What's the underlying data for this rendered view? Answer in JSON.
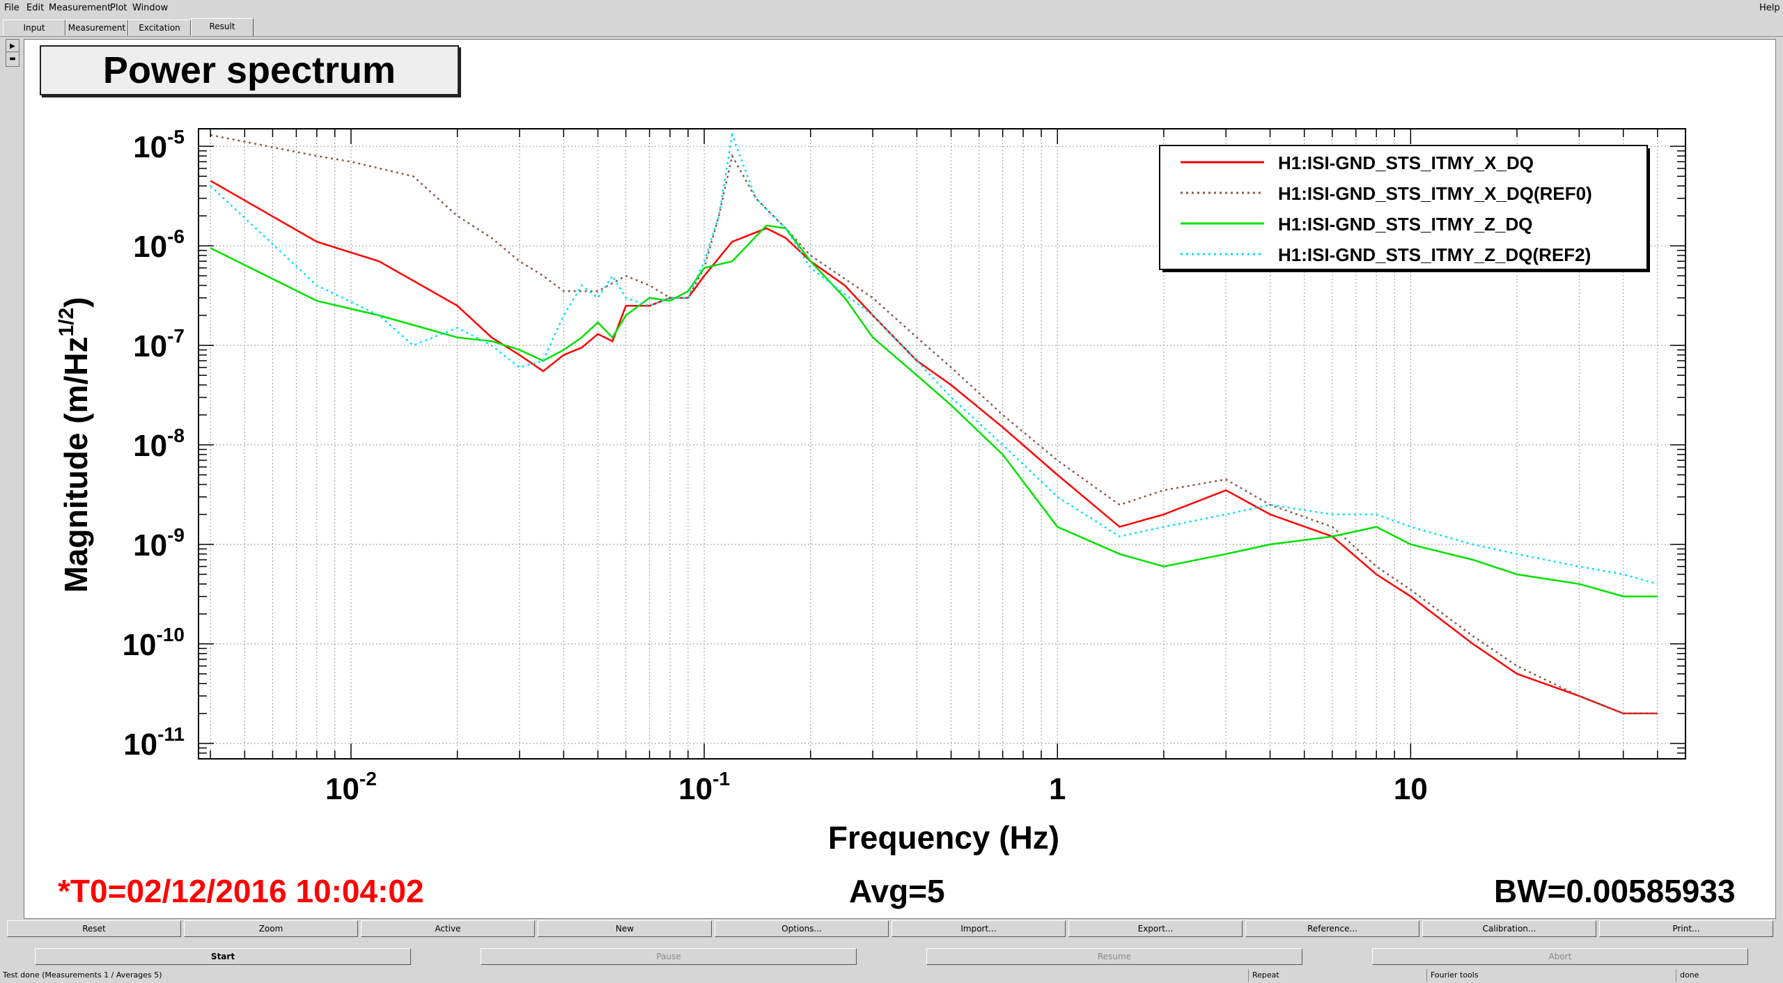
{
  "menu": {
    "items": [
      "File",
      "Edit",
      "Measurement",
      "Plot",
      "Window"
    ],
    "help": "Help"
  },
  "tabs": [
    "Input",
    "Measurement",
    "Excitation",
    "Result"
  ],
  "plot_title": "Power spectrum",
  "footer": {
    "t0": "*T0=02/12/2016 10:04:02",
    "avg": "Avg=5",
    "bw": "BW=0.00585933"
  },
  "buttons_row1": [
    "Reset",
    "Zoom",
    "Active",
    "New",
    "Options...",
    "Import...",
    "Export...",
    "Reference...",
    "Calibration...",
    "Print..."
  ],
  "buttons_row2": [
    "Start",
    "Pause",
    "Resume",
    "Abort"
  ],
  "status": {
    "left": "Test done (Measurements 1 / Averages 5)",
    "repeat": "Repeat",
    "fourier": "Fourier tools",
    "done": "done"
  },
  "colors": {
    "red": "#ff0000",
    "brown": "#8b5a4a",
    "green": "#00e000",
    "cyan": "#00e0ff",
    "t0": "#ff0000"
  },
  "chart_data": {
    "type": "line",
    "title": "Power spectrum",
    "xlabel": "Frequency (Hz)",
    "ylabel": "Magnitude (m/Hz^{1/2})",
    "xscale": "log",
    "yscale": "log",
    "xlim": [
      0.0037,
      60
    ],
    "ylim": [
      7e-12,
      1.5e-05
    ],
    "xticks": [
      {
        "v": 0.01,
        "base": "10",
        "exp": "-2"
      },
      {
        "v": 0.1,
        "base": "10",
        "exp": "-1"
      },
      {
        "v": 1,
        "base": "1",
        "exp": ""
      },
      {
        "v": 10,
        "base": "10",
        "exp": ""
      }
    ],
    "yticks": [
      {
        "v": 1e-05,
        "exp": "-5"
      },
      {
        "v": 1e-06,
        "exp": "-6"
      },
      {
        "v": 1e-07,
        "exp": "-7"
      },
      {
        "v": 1e-08,
        "exp": "-8"
      },
      {
        "v": 1e-09,
        "exp": "-9"
      },
      {
        "v": 1e-10,
        "exp": "-10"
      },
      {
        "v": 1e-11,
        "exp": "-11"
      }
    ],
    "grid": true,
    "legend_position": "top-right",
    "series": [
      {
        "name": "H1:ISI-GND_STS_ITMY_X_DQ",
        "color": "#ff0000",
        "dash": "none",
        "x": [
          0.004,
          0.008,
          0.012,
          0.02,
          0.025,
          0.03,
          0.035,
          0.04,
          0.045,
          0.05,
          0.055,
          0.06,
          0.07,
          0.08,
          0.09,
          0.1,
          0.12,
          0.15,
          0.17,
          0.2,
          0.25,
          0.3,
          0.4,
          0.5,
          0.7,
          1.0,
          1.5,
          2.0,
          3.0,
          4.0,
          6.0,
          8.0,
          10,
          15,
          20,
          30,
          40,
          50
        ],
        "y": [
          4.5e-06,
          1.1e-06,
          7e-07,
          2.5e-07,
          1.2e-07,
          8e-08,
          5.5e-08,
          8e-08,
          9.5e-08,
          1.3e-07,
          1.1e-07,
          2.5e-07,
          2.5e-07,
          3e-07,
          3e-07,
          5e-07,
          1.1e-06,
          1.5e-06,
          1.2e-06,
          7e-07,
          4e-07,
          2e-07,
          7e-08,
          4e-08,
          1.5e-08,
          5e-09,
          1.5e-09,
          2e-09,
          3.5e-09,
          2e-09,
          1.2e-09,
          5e-10,
          3e-10,
          1e-10,
          5e-11,
          3e-11,
          2e-11,
          2e-11
        ]
      },
      {
        "name": "H1:ISI-GND_STS_ITMY_X_DQ(REF0)",
        "color": "#8b5a4a",
        "dash": "3,5",
        "x": [
          0.004,
          0.008,
          0.01,
          0.015,
          0.02,
          0.025,
          0.03,
          0.035,
          0.04,
          0.05,
          0.06,
          0.07,
          0.08,
          0.09,
          0.1,
          0.11,
          0.12,
          0.14,
          0.17,
          0.2,
          0.3,
          0.4,
          0.5,
          0.7,
          1.0,
          1.5,
          2.0,
          3.0,
          4.0,
          6.0,
          8.0,
          10,
          15,
          20,
          30,
          40,
          50
        ],
        "y": [
          1.3e-05,
          8e-06,
          7e-06,
          5e-06,
          2e-06,
          1.2e-06,
          7e-07,
          5e-07,
          3.5e-07,
          3.5e-07,
          5e-07,
          4e-07,
          3e-07,
          3e-07,
          6e-07,
          2e-06,
          8e-06,
          3e-06,
          1.5e-06,
          8e-07,
          3e-07,
          1.2e-07,
          6e-08,
          2e-08,
          7e-09,
          2.5e-09,
          3.5e-09,
          4.5e-09,
          2.5e-09,
          1.5e-09,
          6e-10,
          3.5e-10,
          1.2e-10,
          6e-11,
          3e-11,
          2e-11,
          2e-11
        ]
      },
      {
        "name": "H1:ISI-GND_STS_ITMY_Z_DQ",
        "color": "#00e000",
        "dash": "none",
        "x": [
          0.004,
          0.008,
          0.012,
          0.02,
          0.025,
          0.03,
          0.035,
          0.04,
          0.045,
          0.05,
          0.055,
          0.06,
          0.07,
          0.08,
          0.09,
          0.1,
          0.12,
          0.15,
          0.17,
          0.2,
          0.25,
          0.3,
          0.4,
          0.5,
          0.7,
          1.0,
          1.5,
          2.0,
          3.0,
          4.0,
          6.0,
          8.0,
          10,
          15,
          20,
          30,
          40,
          50
        ],
        "y": [
          9.5e-07,
          2.8e-07,
          2e-07,
          1.2e-07,
          1.1e-07,
          9e-08,
          7e-08,
          9e-08,
          1.2e-07,
          1.7e-07,
          1.2e-07,
          2e-07,
          3e-07,
          2.8e-07,
          3.5e-07,
          6e-07,
          7e-07,
          1.6e-06,
          1.5e-06,
          7e-07,
          3e-07,
          1.2e-07,
          5e-08,
          2.5e-08,
          8e-09,
          1.5e-09,
          8e-10,
          6e-10,
          8e-10,
          1e-09,
          1.2e-09,
          1.5e-09,
          1e-09,
          7e-10,
          5e-10,
          4e-10,
          3e-10,
          3e-10
        ]
      },
      {
        "name": "H1:ISI-GND_STS_ITMY_Z_DQ(REF2)",
        "color": "#00e0ff",
        "dash": "3,5",
        "x": [
          0.004,
          0.008,
          0.012,
          0.015,
          0.02,
          0.025,
          0.03,
          0.035,
          0.04,
          0.045,
          0.05,
          0.055,
          0.06,
          0.07,
          0.08,
          0.09,
          0.1,
          0.11,
          0.12,
          0.14,
          0.17,
          0.2,
          0.3,
          0.4,
          0.5,
          0.7,
          1.0,
          1.5,
          2.0,
          3.0,
          4.0,
          6.0,
          8.0,
          10,
          15,
          20,
          30,
          40,
          50
        ],
        "y": [
          4e-06,
          4e-07,
          2e-07,
          1e-07,
          1.5e-07,
          1e-07,
          6e-08,
          7e-08,
          2e-07,
          4e-07,
          3e-07,
          5e-07,
          3e-07,
          2.5e-07,
          3e-07,
          3e-07,
          7e-07,
          2e-06,
          1.3e-05,
          3e-06,
          1.5e-06,
          6e-07,
          2e-07,
          7e-08,
          3e-08,
          1e-08,
          3e-09,
          1.2e-09,
          1.5e-09,
          2e-09,
          2.5e-09,
          2e-09,
          2e-09,
          1.5e-09,
          1e-09,
          8e-10,
          6e-10,
          5e-10,
          4e-10
        ]
      }
    ]
  }
}
